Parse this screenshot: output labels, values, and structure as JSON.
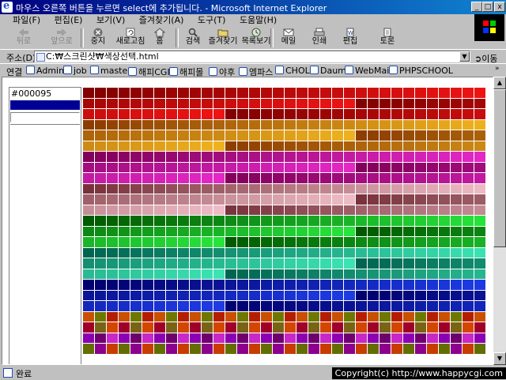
{
  "window": {
    "title": "마우스 오른쪽 버튼을 누르면 select에 추가됩니다. - Microsoft Internet Explorer",
    "buttons": {
      "minimize": "_",
      "maximize": "□",
      "close": "x"
    }
  },
  "menu": [
    "파일(F)",
    "편집(E)",
    "보기(V)",
    "즐겨찾기(A)",
    "도구(T)",
    "도움말(H)"
  ],
  "toolbar": {
    "back": "뒤로",
    "forward": "앞으로",
    "stop": "중지",
    "refresh": "새로고침",
    "home": "홈",
    "search": "검색",
    "favorites": "즐겨찾기",
    "history": "목록보기",
    "mail": "메일",
    "print": "인쇄",
    "edit": "편집",
    "discuss": "토론"
  },
  "address": {
    "label": "주소(D)",
    "value": "C:₩스크린샷₩색상선택.html",
    "go": "이동"
  },
  "links": {
    "label": "연결",
    "items": [
      "Admin",
      "job",
      "master",
      "해피CGI",
      "해피몰",
      "야후",
      "엠파스",
      "CHOL",
      "Daum",
      "WebMail",
      "PHPSCHOOL"
    ]
  },
  "page": {
    "selected_hex": "#000095",
    "selected_color": "#000095"
  },
  "colors": {
    "titlebar_start": "#000080",
    "titlebar_end": "#1084d0",
    "chrome": "#c0c0c0"
  },
  "status": {
    "text": "완료"
  },
  "overlay": {
    "copyright": "Copyright(c) http://www.happycgi.com"
  }
}
